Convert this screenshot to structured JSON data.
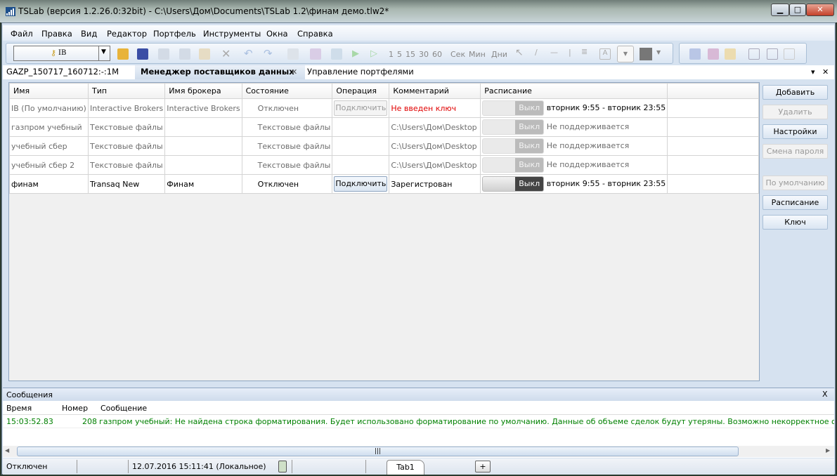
{
  "window": {
    "title": "TSLab (версия 1.2.26.0:32bit) - C:\\Users\\Дом\\Documents\\TSLab 1.2\\финам демо.tlw2*",
    "minimize": "▁",
    "maximize": "□",
    "close": "✕"
  },
  "menu": [
    "Файл",
    "Правка",
    "Вид",
    "Редактор",
    "Портфель",
    "Инструменты",
    "Окна",
    "Справка"
  ],
  "toolbar": {
    "provider_select": "IB",
    "periods": [
      "1",
      "5",
      "15",
      "30",
      "60"
    ],
    "units": [
      "Сек",
      "Мин",
      "Дни"
    ]
  },
  "tabs": [
    {
      "label": "GAZP_150717_160712:-:1M"
    },
    {
      "label": "Менеджер поставщиков данных",
      "active": true,
      "close": "✕"
    },
    {
      "label": "Управление портфелями"
    }
  ],
  "tabbar_controls": {
    "menu": "▾",
    "close": "✕"
  },
  "table": {
    "columns": [
      "Имя",
      "Тип",
      "Имя брокера",
      "Состояние",
      "Операция",
      "Комментарий",
      "Расписание"
    ],
    "rows": [
      {
        "name": "IB (По умолчанию)",
        "type": "Interactive Brokers",
        "broker": "Interactive Brokers",
        "state": "Отключен",
        "operation": "Подключить",
        "operation_enabled": false,
        "comment": "Не введен ключ",
        "comment_error": true,
        "toggle": "Выкл",
        "toggle_enabled": false,
        "schedule": "вторник 9:55 - вторник 23:55",
        "active": false
      },
      {
        "name": "газпром учебный",
        "type": "Текстовые файлы",
        "broker": "",
        "state": "Текстовые файлы",
        "operation": "",
        "comment": "C:\\Users\\Дом\\Desktop",
        "toggle": "Выкл",
        "toggle_enabled": false,
        "schedule": "Не поддерживается",
        "active": false
      },
      {
        "name": "учебный сбер",
        "type": "Текстовые файлы",
        "broker": "",
        "state": "Текстовые файлы",
        "operation": "",
        "comment": "C:\\Users\\Дом\\Desktop",
        "toggle": "Выкл",
        "toggle_enabled": false,
        "schedule": "Не поддерживается",
        "active": false
      },
      {
        "name": "учебный сбер 2",
        "type": "Текстовые файлы",
        "broker": "",
        "state": "Текстовые файлы",
        "operation": "",
        "comment": "C:\\Users\\Дом\\Desktop",
        "toggle": "Выкл",
        "toggle_enabled": false,
        "schedule": "Не поддерживается",
        "active": false
      },
      {
        "name": "финам",
        "type": "Transaq New",
        "broker": "Финам",
        "state": "Отключен",
        "operation": "Подключить",
        "operation_enabled": true,
        "comment": "Зарегистрован",
        "toggle": "Выкл",
        "toggle_enabled": true,
        "schedule": "вторник 9:55 - вторник 23:55",
        "active": true
      }
    ]
  },
  "side_buttons": [
    {
      "label": "Добавить",
      "enabled": true
    },
    {
      "label": "Удалить",
      "enabled": false
    },
    {
      "label": "Настройки",
      "enabled": true
    },
    {
      "label": "Смена пароля",
      "enabled": false
    },
    {
      "label": "По умолчанию",
      "enabled": false
    },
    {
      "label": "Расписание",
      "enabled": true
    },
    {
      "label": "Ключ",
      "enabled": true
    }
  ],
  "messages": {
    "title": "Сообщения",
    "close": "X",
    "columns": [
      "Время",
      "Номер",
      "Сообщение"
    ],
    "rows": [
      {
        "time": "15:03:52.83",
        "number": "208",
        "text": "газпром учебный: Не найдена строка форматирования. Будет использовано форматирование по умолчанию. Данные об объеме сделок будут утеряны. Возможно некорректное отоб"
      }
    ]
  },
  "status": {
    "connection": "Отключен",
    "datetime": "12.07.2016 15:11:41 (Локальное)",
    "tab": "Tab1",
    "add_tab": "+"
  },
  "colors": {
    "error": "#e00000",
    "message": "#008000",
    "accent": "#8ea5c0"
  }
}
